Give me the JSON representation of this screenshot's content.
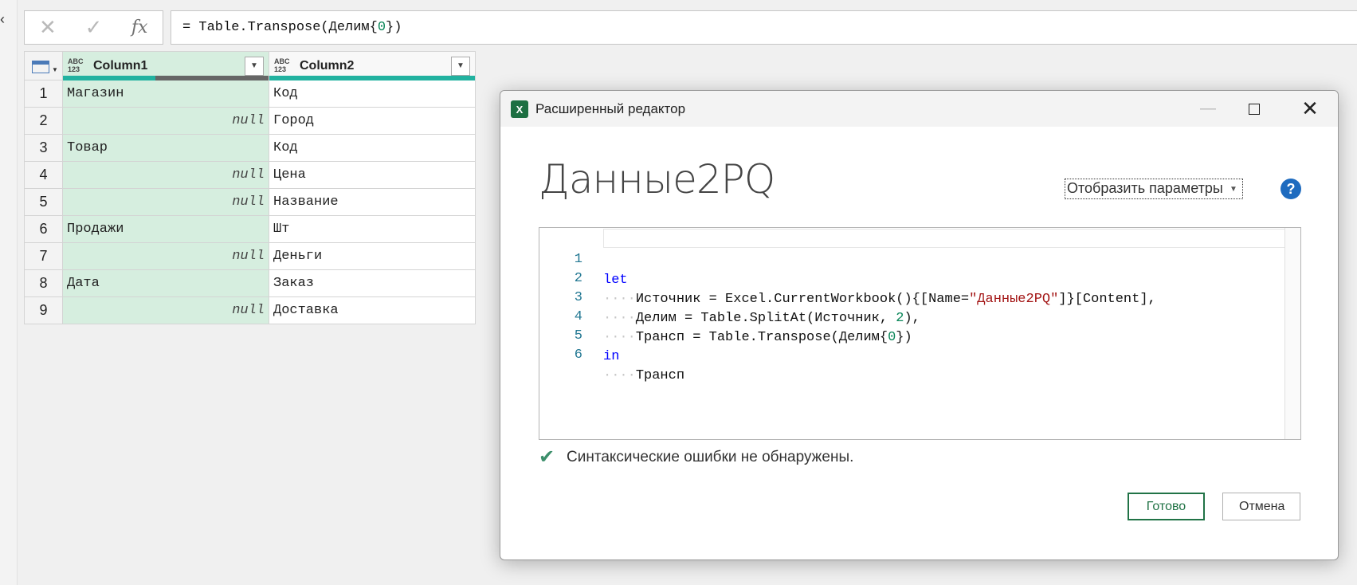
{
  "formula_bar": {
    "cancel_icon": "✕",
    "commit_icon": "✓",
    "fx_label": "fx",
    "formula_prefix": "= Table.Transpose(Делим{",
    "formula_index": "0",
    "formula_suffix": "})"
  },
  "grid": {
    "columns": [
      {
        "type_label": "ABC\n123",
        "name": "Column1"
      },
      {
        "type_label": "ABC\n123",
        "name": "Column2"
      }
    ],
    "rows": [
      {
        "n": "1",
        "c1": "Магазин",
        "c2": "Код"
      },
      {
        "n": "2",
        "c1": "null",
        "c2": "Город"
      },
      {
        "n": "3",
        "c1": "Товар",
        "c2": "Код"
      },
      {
        "n": "4",
        "c1": "null",
        "c2": "Цена"
      },
      {
        "n": "5",
        "c1": "null",
        "c2": "Название"
      },
      {
        "n": "6",
        "c1": "Продажи",
        "c2": "Шт"
      },
      {
        "n": "7",
        "c1": "null",
        "c2": "Деньги"
      },
      {
        "n": "8",
        "c1": "Дата",
        "c2": "Заказ"
      },
      {
        "n": "9",
        "c1": "null",
        "c2": "Доставка"
      }
    ]
  },
  "dialog": {
    "title": "Расширенный редактор",
    "query_name": "Данные2PQ",
    "display_options": "Отобразить параметры",
    "help_glyph": "?",
    "code": {
      "line_numbers": [
        "1",
        "2",
        "3",
        "4",
        "5",
        "6"
      ],
      "l1_kw": "let",
      "ws_dots": "····",
      "l2_a": "Источник",
      "l2_b": " = Excel.CurrentWorkbook(){[Name=",
      "l2_str": "\"Данные2PQ\"",
      "l2_c": "]}[Content],",
      "l3_a": "Делим",
      "l3_b": " = Table.SplitAt(Источник, ",
      "l3_num": "2",
      "l3_c": "),",
      "l4_a": "Трансп",
      "l4_b": " = Table.Transpose(Делим{",
      "l4_num": "0",
      "l4_c": "})",
      "l5_kw": "in",
      "l6_a": "Трансп"
    },
    "status": "Синтаксические ошибки не обнаружены.",
    "ok_label": "Готово",
    "cancel_label": "Отмена"
  },
  "colors": {
    "accent_green": "#217346",
    "column_highlight": "#d6eedf",
    "quality_bar": "#22b2a0"
  }
}
